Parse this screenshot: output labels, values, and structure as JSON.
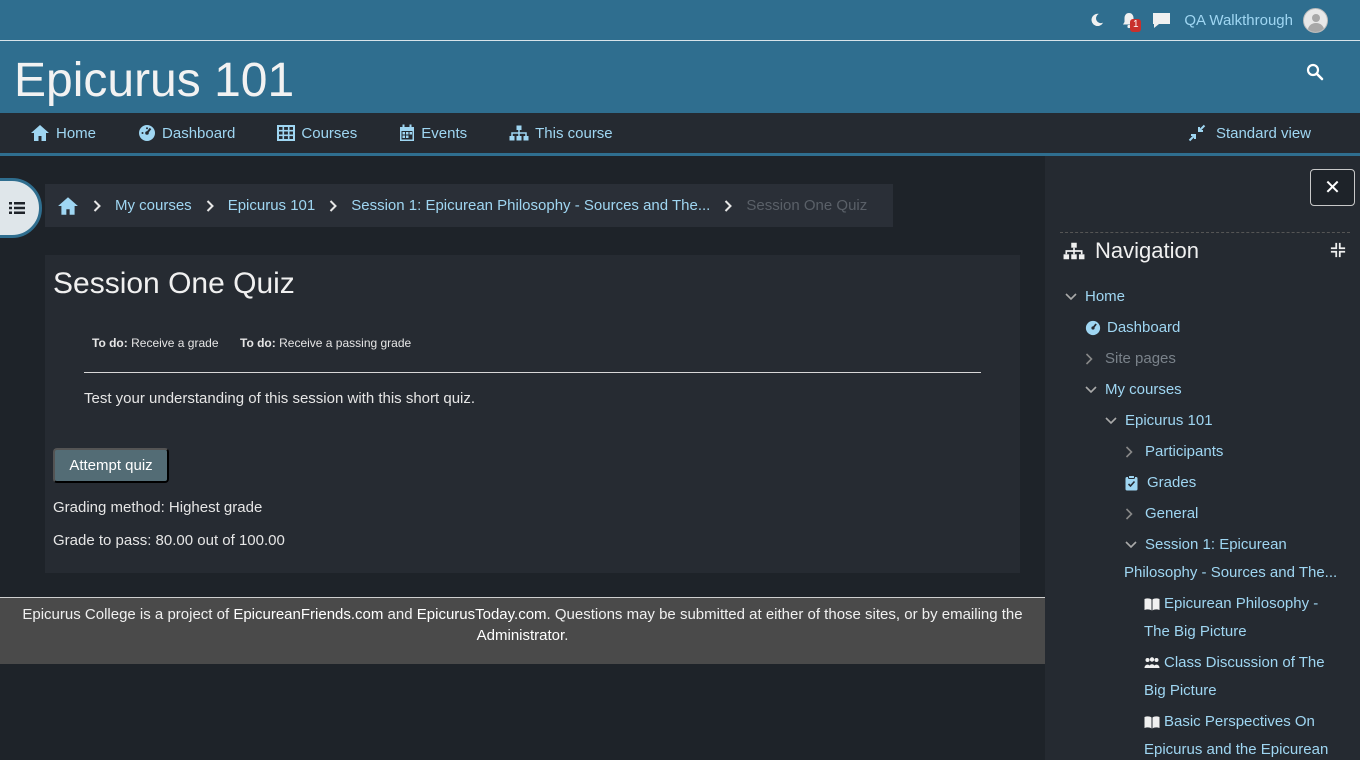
{
  "topbar": {
    "notification_count": "1",
    "username": "QA Walkthrough",
    "icons": [
      "moon-icon",
      "bell-icon",
      "chat-icon",
      "avatar"
    ]
  },
  "header": {
    "site_title": "Epicurus 101"
  },
  "primary_nav": {
    "items": [
      {
        "label": "Home",
        "icon": "home-icon"
      },
      {
        "label": "Dashboard",
        "icon": "dashboard-icon"
      },
      {
        "label": "Courses",
        "icon": "grid-icon"
      },
      {
        "label": "Events",
        "icon": "calendar-icon"
      },
      {
        "label": "This course",
        "icon": "sitemap-icon"
      }
    ],
    "standard_view": "Standard view"
  },
  "breadcrumb": {
    "items": [
      "My courses",
      "Epicurus 101",
      "Session 1: Epicurean Philosophy - Sources and The..."
    ],
    "current": "Session One Quiz"
  },
  "main": {
    "title": "Session One Quiz",
    "todos": [
      {
        "prefix": "To do:",
        "text": "Receive a grade"
      },
      {
        "prefix": "To do:",
        "text": "Receive a passing grade"
      }
    ],
    "intro": "Test your understanding of this session with this short quiz.",
    "attempt_button": "Attempt quiz",
    "grading_method": "Grading method: Highest grade",
    "grade_to_pass": "Grade to pass: 80.00 out of 100.00"
  },
  "footer": {
    "t1": "Epicurus College is a project of ",
    "link1": "EpicureanFriends.com",
    "t2": " and ",
    "link2": "EpicurusToday.com",
    "t3": ". Questions may be submitted at either of those sites, or by emailing the ",
    "link3": "Administrator",
    "t4": "."
  },
  "drawer": {
    "close": "✕",
    "title": "Navigation",
    "tree": {
      "home": "Home",
      "dashboard": "Dashboard",
      "site_pages": "Site pages",
      "my_courses": "My courses",
      "course": "Epicurus 101",
      "participants": "Participants",
      "grades": "Grades",
      "general": "General",
      "session1_line1": "Session 1: Epicurean",
      "session1_line2": "Philosophy - Sources and The...",
      "big_picture_l1": "Epicurean Philosophy -",
      "big_picture_l2": "The Big Picture",
      "discussion_l1": "Class Discussion of The",
      "discussion_l2": "Big Picture",
      "perspectives_l1": "Basic Perspectives On",
      "perspectives_l2": "Epicurus and the Epicurean"
    }
  },
  "colors": {
    "brand": "#2f6e8f",
    "link": "#9fd6f2",
    "background": "#1e2329",
    "badge": "#c9302c"
  }
}
